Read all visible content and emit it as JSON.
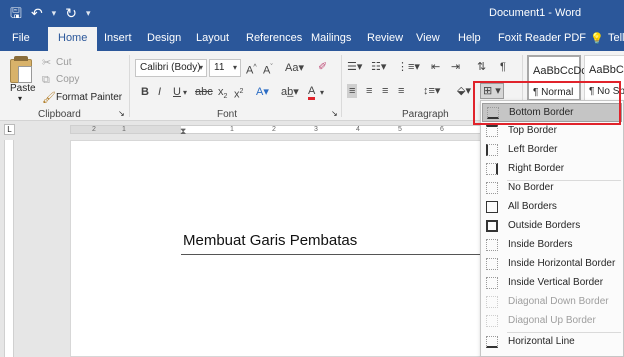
{
  "quick_access": {
    "save": "🖫",
    "undo": "↶",
    "redo": "↻"
  },
  "title": "Document1 - Word",
  "tabs": [
    "File",
    "Home",
    "Insert",
    "Design",
    "Layout",
    "References",
    "Mailings",
    "Review",
    "View",
    "Help",
    "Foxit Reader PDF"
  ],
  "tell_me": "Tell",
  "clipboard": {
    "paste": "Paste",
    "cut": "Cut",
    "copy": "Copy",
    "format_painter": "Format Painter",
    "label": "Clipboard"
  },
  "font": {
    "name": "Calibri (Body)",
    "size": "11",
    "label": "Font"
  },
  "paragraph": {
    "label": "Paragraph"
  },
  "styles": [
    {
      "sample": "AaBbCcDc",
      "name": "¶ Normal"
    },
    {
      "sample": "AaBbCc",
      "name": "¶ No Spa"
    }
  ],
  "ruler_numbers": [
    "2",
    "1",
    "1",
    "2",
    "3",
    "4",
    "5",
    "6"
  ],
  "document": {
    "heading": "Membuat Garis Pembatas"
  },
  "border_menu": {
    "items": [
      {
        "label": "Bottom Border",
        "icon": "bottom-border-icon",
        "enabled": true,
        "highlighted": true
      },
      {
        "label": "Top Border",
        "icon": "top-border-icon",
        "enabled": true
      },
      {
        "label": "Left Border",
        "icon": "left-border-icon",
        "enabled": true
      },
      {
        "label": "Right Border",
        "icon": "right-border-icon",
        "enabled": true
      },
      {
        "label": "No Border",
        "icon": "no-border-icon",
        "enabled": true
      },
      {
        "label": "All Borders",
        "icon": "all-borders-icon",
        "enabled": true
      },
      {
        "label": "Outside Borders",
        "icon": "outside-borders-icon",
        "enabled": true
      },
      {
        "label": "Inside Borders",
        "icon": "inside-borders-icon",
        "enabled": true
      },
      {
        "label": "Inside Horizontal Border",
        "icon": "inside-horizontal-border-icon",
        "enabled": true
      },
      {
        "label": "Inside Vertical Border",
        "icon": "inside-vertical-border-icon",
        "enabled": true
      },
      {
        "label": "Diagonal Down Border",
        "icon": "diagonal-down-border-icon",
        "enabled": false
      },
      {
        "label": "Diagonal Up Border",
        "icon": "diagonal-up-border-icon",
        "enabled": false
      },
      {
        "label": "Horizontal Line",
        "icon": "horizontal-line-icon",
        "enabled": true
      }
    ]
  },
  "colors": {
    "brand": "#2b579a",
    "highlight_outline": "#e0232b"
  }
}
